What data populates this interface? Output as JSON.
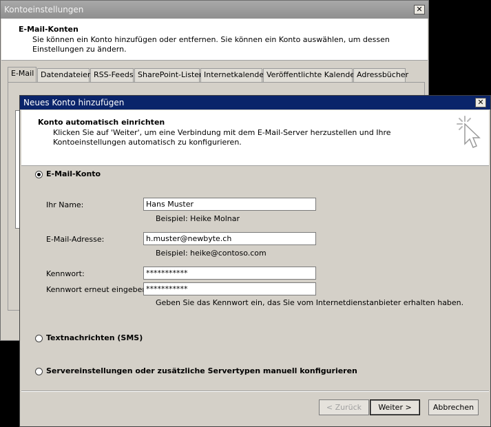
{
  "back_window": {
    "title": "Kontoeinstellungen",
    "close_label": "✕",
    "header_title": "E-Mail-Konten",
    "header_desc": "Sie können ein Konto hinzufügen oder entfernen. Sie können ein Konto auswählen, um dessen Einstellungen zu ändern.",
    "tabs": [
      "E-Mail",
      "Datendateien",
      "RSS-Feeds",
      "SharePoint-Listen",
      "Internetkalender",
      "Veröffentlichte Kalender",
      "Adressbücher"
    ],
    "active_tab": "E-Mail"
  },
  "dialog": {
    "title": "Neues Konto hinzufügen",
    "close_label": "✕",
    "header_title": "Konto automatisch einrichten",
    "header_desc": "Klicken Sie auf 'Weiter', um eine Verbindung mit dem E-Mail-Server herzustellen und Ihre Kontoeinstellungen automatisch zu konfigurieren.",
    "options": {
      "email_account": {
        "label": "E-Mail-Konto",
        "selected": true
      },
      "sms": {
        "label": "Textnachrichten (SMS)",
        "selected": false
      },
      "manual": {
        "label": "Servereinstellungen oder zusätzliche Servertypen manuell konfigurieren",
        "selected": false
      }
    },
    "form": {
      "name_label": "Ihr Name:",
      "name_value": "Hans Muster",
      "name_hint": "Beispiel: Heike Molnar",
      "email_label": "E-Mail-Adresse:",
      "email_value": "h.muster@newbyte.ch",
      "email_hint": "Beispiel: heike@contoso.com",
      "password_label": "Kennwort:",
      "password_value": "***********",
      "password_repeat_label": "Kennwort erneut eingeben:",
      "password_repeat_value": "***********",
      "password_hint": "Geben Sie das Kennwort ein, das Sie vom Internetdienstanbieter erhalten haben."
    },
    "buttons": {
      "back": "< Zurück",
      "next": "Weiter >",
      "cancel": "Abbrechen"
    }
  }
}
